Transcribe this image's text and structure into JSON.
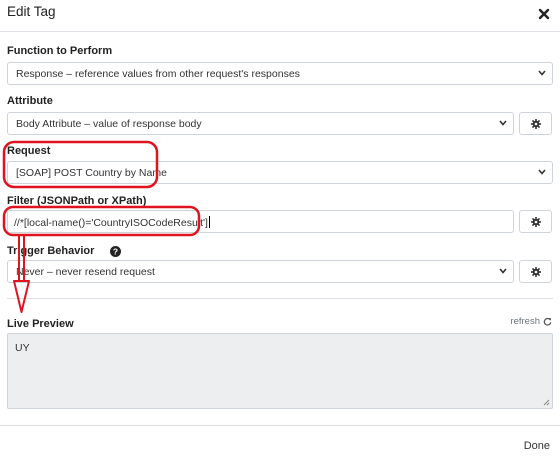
{
  "dialog": {
    "title": "Edit Tag",
    "done_label": "Done"
  },
  "function": {
    "label": "Function to Perform",
    "value": "Response – reference values from other request's responses"
  },
  "attribute": {
    "label": "Attribute",
    "value": "Body Attribute – value of response body"
  },
  "request": {
    "label": "Request",
    "value": "[SOAP] POST Country by Name"
  },
  "filter": {
    "label": "Filter (JSONPath or XPath)",
    "value": "//*[local-name()='CountryISOCodeResult']"
  },
  "trigger": {
    "label": "Trigger Behavior",
    "value": "Never – never resend request"
  },
  "preview": {
    "label": "Live Preview",
    "refresh_label": "refresh",
    "value": "UY"
  },
  "annotation_color": "#e0141e",
  "icons": [
    "close-icon",
    "chevron-down-icon",
    "gear-icon",
    "question-circle-icon",
    "refresh-icon",
    "resize-handle-icon"
  ]
}
